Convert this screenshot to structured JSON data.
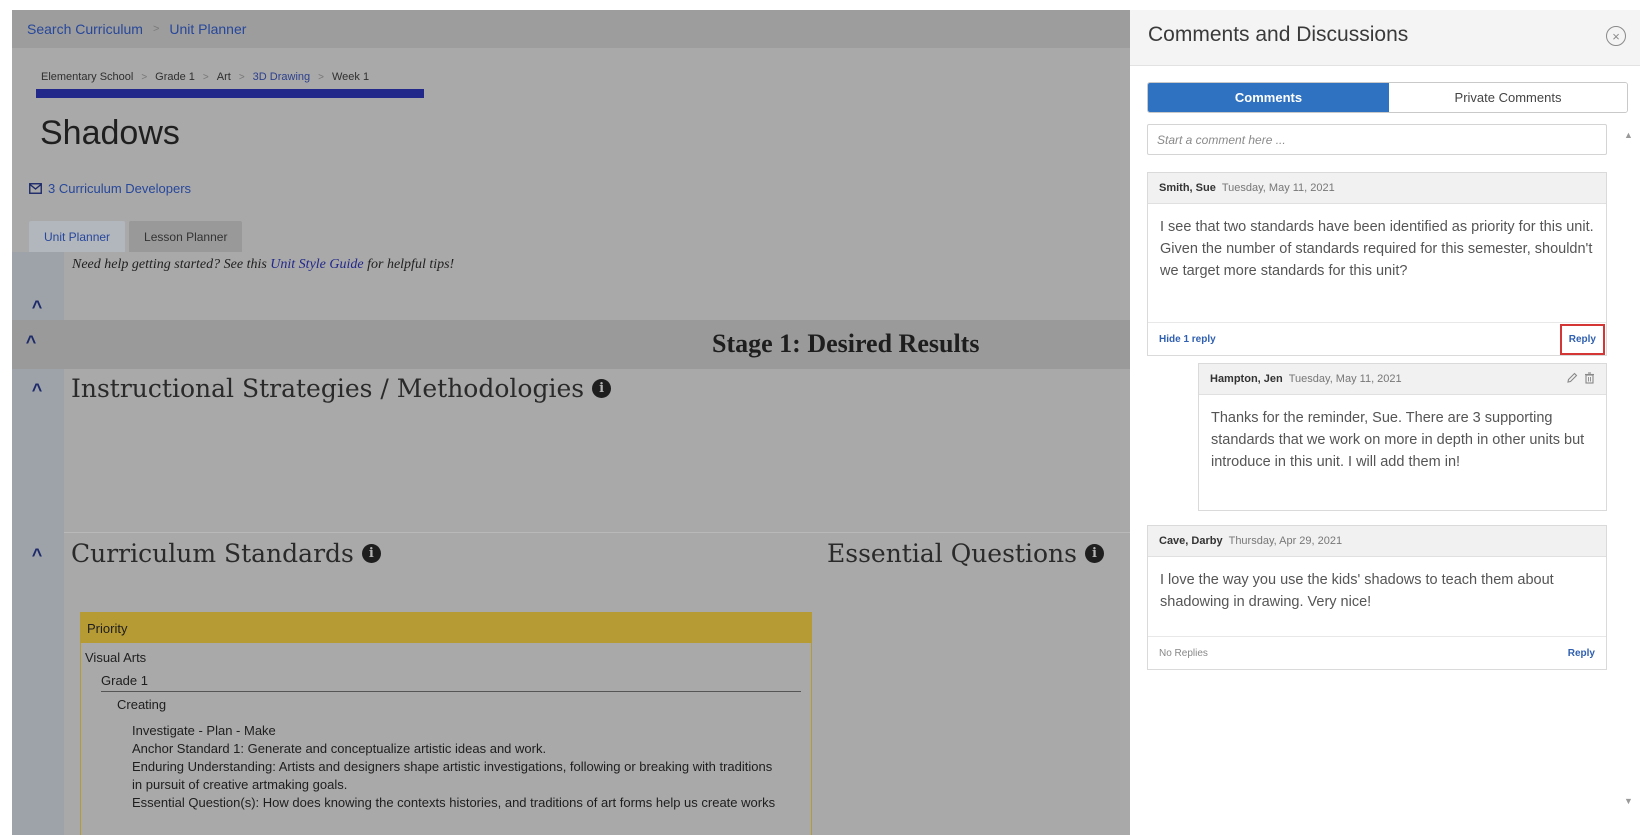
{
  "topbar": {
    "crumbs": [
      "Search Curriculum",
      "Unit Planner"
    ]
  },
  "path": {
    "items": [
      "Elementary School",
      "Grade 1",
      "Art",
      "3D Drawing",
      "Week 1"
    ]
  },
  "page": {
    "title": "Shadows",
    "developers": "3 Curriculum Developers",
    "tabs": [
      "Unit Planner",
      "Lesson Planner"
    ],
    "help": {
      "before": "Need help getting started? See this ",
      "link": "Unit Style Guide",
      "after": " for helpful tips!"
    },
    "stage_title": "Stage 1: Desired Results",
    "sections": {
      "instructional": "Instructional Strategies / Methodologies",
      "standards": "Curriculum Standards",
      "questions": "Essential Questions"
    },
    "standards": {
      "priority": "Priority",
      "subject": "Visual Arts",
      "grade": "Grade 1",
      "strand": "Creating",
      "process": "Investigate - Plan - Make",
      "anchor": "Anchor Standard 1: Generate and conceptualize artistic ideas and work.",
      "understanding_1": "Enduring Understanding: Artists and designers shape artistic investigations, following or breaking with traditions",
      "understanding_2": "in pursuit of creative artmaking goals.",
      "question": "Essential Question(s): How does knowing the contexts histories, and traditions of art forms help us create works"
    }
  },
  "panel": {
    "title": "Comments and Discussions",
    "close_glyph": "×",
    "tabs": {
      "comments": "Comments",
      "private": "Private Comments"
    },
    "input_placeholder": "Start a comment here ...",
    "comments": [
      {
        "author": "Smith, Sue",
        "date": "Tuesday, May 11, 2021",
        "text": "I see that two standards have been identified as priority for this unit. Given the number of standards required for this semester, shouldn't we target more standards for this unit?",
        "footer_left": "Hide 1 reply",
        "footer_right": "Reply"
      },
      {
        "author": "Hampton, Jen",
        "date": "Tuesday, May 11, 2021",
        "text": "Thanks for the reminder, Sue. There are 3 supporting standards that we work on more in depth in other units but introduce in this unit. I will add them in!"
      },
      {
        "author": "Cave, Darby",
        "date": "Thursday, Apr 29, 2021",
        "text": "I love the way you use the kids' shadows to teach them about shadowing in drawing. Very nice!",
        "footer_left": "No Replies",
        "footer_right": "Reply"
      }
    ]
  },
  "icons": {
    "separator": "chevron-right-icon",
    "developers": "envelope-icon",
    "collapse": "chevron-up-icon",
    "info": "info-icon",
    "close": "close-circle-icon",
    "edit": "pencil-icon",
    "delete": "trash-icon"
  },
  "colors": {
    "accent": "#2f72c2",
    "link": "#2f5fb0",
    "priority": "#b69a34",
    "highlight": "#d43636",
    "title_bar": "#22288a"
  }
}
